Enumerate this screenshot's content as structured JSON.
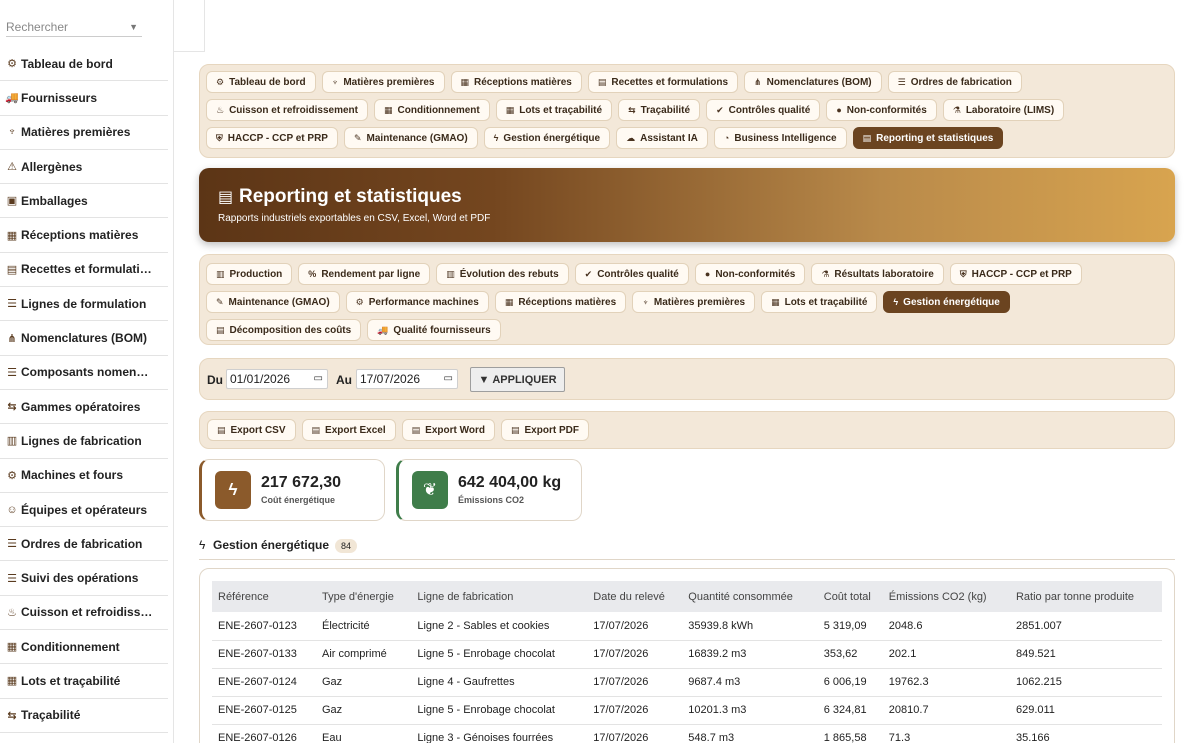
{
  "sidebar": {
    "search_placeholder": "Rechercher",
    "items": [
      {
        "icon": "⚙",
        "label": "Tableau de bord"
      },
      {
        "icon": "🚚",
        "label": "Fournisseurs"
      },
      {
        "icon": "♆",
        "label": "Matières premières"
      },
      {
        "icon": "⚠",
        "label": "Allergènes"
      },
      {
        "icon": "▣",
        "label": "Emballages"
      },
      {
        "icon": "▦",
        "label": "Réceptions matières"
      },
      {
        "icon": "▤",
        "label": "Recettes et formulati…"
      },
      {
        "icon": "☰",
        "label": "Lignes de formulation"
      },
      {
        "icon": "⋔",
        "label": "Nomenclatures (BOM)"
      },
      {
        "icon": "☰",
        "label": "Composants nomen…"
      },
      {
        "icon": "⇆",
        "label": "Gammes opératoires"
      },
      {
        "icon": "▥",
        "label": "Lignes de fabrication"
      },
      {
        "icon": "⚙",
        "label": "Machines et fours"
      },
      {
        "icon": "☺",
        "label": "Équipes et opérateurs"
      },
      {
        "icon": "☰",
        "label": "Ordres de fabrication"
      },
      {
        "icon": "☰",
        "label": "Suivi des opérations"
      },
      {
        "icon": "♨",
        "label": "Cuisson et refroidiss…"
      },
      {
        "icon": "▦",
        "label": "Conditionnement"
      },
      {
        "icon": "▦",
        "label": "Lots et traçabilité"
      },
      {
        "icon": "⇆",
        "label": "Traçabilité"
      }
    ]
  },
  "top_nav": [
    {
      "icon": "⚙",
      "label": "Tableau de bord"
    },
    {
      "icon": "♆",
      "label": "Matières premières"
    },
    {
      "icon": "▦",
      "label": "Réceptions matières"
    },
    {
      "icon": "▤",
      "label": "Recettes et formulations"
    },
    {
      "icon": "⋔",
      "label": "Nomenclatures (BOM)"
    },
    {
      "icon": "☰",
      "label": "Ordres de fabrication"
    },
    {
      "icon": "♨",
      "label": "Cuisson et refroidissement"
    },
    {
      "icon": "▦",
      "label": "Conditionnement"
    },
    {
      "icon": "▦",
      "label": "Lots et traçabilité"
    },
    {
      "icon": "⇆",
      "label": "Traçabilité"
    },
    {
      "icon": "✔",
      "label": "Contrôles qualité"
    },
    {
      "icon": "●",
      "label": "Non-conformités"
    },
    {
      "icon": "⚗",
      "label": "Laboratoire (LIMS)"
    },
    {
      "icon": "⛨",
      "label": "HACCP - CCP et PRP"
    },
    {
      "icon": "✎",
      "label": "Maintenance (GMAO)"
    },
    {
      "icon": "ϟ",
      "label": "Gestion énergétique"
    },
    {
      "icon": "☁",
      "label": "Assistant IA"
    },
    {
      "icon": "◔",
      "label": "Business Intelligence"
    },
    {
      "icon": "▤",
      "label": "Reporting et statistiques",
      "active": true
    }
  ],
  "hero": {
    "icon": "▤",
    "title": "Reporting et statistiques",
    "subtitle": "Rapports industriels exportables en CSV, Excel, Word et PDF"
  },
  "sub_nav": [
    {
      "icon": "▥",
      "label": "Production"
    },
    {
      "icon": "%",
      "label": "Rendement par ligne"
    },
    {
      "icon": "▥",
      "label": "Évolution des rebuts"
    },
    {
      "icon": "✔",
      "label": "Contrôles qualité"
    },
    {
      "icon": "●",
      "label": "Non-conformités"
    },
    {
      "icon": "⚗",
      "label": "Résultats laboratoire"
    },
    {
      "icon": "⛨",
      "label": "HACCP - CCP et PRP"
    },
    {
      "icon": "✎",
      "label": "Maintenance (GMAO)"
    },
    {
      "icon": "⚙",
      "label": "Performance machines"
    },
    {
      "icon": "▦",
      "label": "Réceptions matières"
    },
    {
      "icon": "♆",
      "label": "Matières premières"
    },
    {
      "icon": "▦",
      "label": "Lots et traçabilité"
    },
    {
      "icon": "ϟ",
      "label": "Gestion énergétique",
      "active": true
    },
    {
      "icon": "▤",
      "label": "Décomposition des coûts"
    },
    {
      "icon": "🚚",
      "label": "Qualité fournisseurs"
    }
  ],
  "date_filter": {
    "from_label": "Du",
    "from_value": "01/01/2026",
    "to_label": "Au",
    "to_value": "17/07/2026",
    "apply_label": "APPLIQUER"
  },
  "exports": [
    {
      "icon": "▤",
      "label": "Export CSV"
    },
    {
      "icon": "▤",
      "label": "Export Excel"
    },
    {
      "icon": "▤",
      "label": "Export Word"
    },
    {
      "icon": "▤",
      "label": "Export PDF"
    }
  ],
  "kpis": [
    {
      "value": "217 672,30",
      "caption": "Coût énergétique",
      "color": "#8b5a2b"
    },
    {
      "value": "642 404,00 kg",
      "caption": "Émissions CO2",
      "color": "#3f7d4a"
    }
  ],
  "section": {
    "title": "Gestion énergétique",
    "count": "84"
  },
  "table": {
    "columns": [
      "Référence",
      "Type d'énergie",
      "Ligne de fabrication",
      "Date du relevé",
      "Quantité consommée",
      "Coût total",
      "Émissions CO2 (kg)",
      "Ratio par tonne produite"
    ],
    "rows": [
      [
        "ENE-2607-0123",
        "Électricité",
        "Ligne 2 - Sables et cookies",
        "17/07/2026",
        "35939.8 kWh",
        "5 319,09",
        "2048.6",
        "2851.007"
      ],
      [
        "ENE-2607-0133",
        "Air comprimé",
        "Ligne 5 - Enrobage chocolat",
        "17/07/2026",
        "16839.2 m3",
        "353,62",
        "202.1",
        "849.521"
      ],
      [
        "ENE-2607-0124",
        "Gaz",
        "Ligne 4 - Gaufrettes",
        "17/07/2026",
        "9687.4 m3",
        "6 006,19",
        "19762.3",
        "1062.215"
      ],
      [
        "ENE-2607-0125",
        "Gaz",
        "Ligne 5 - Enrobage chocolat",
        "17/07/2026",
        "10201.3 m3",
        "6 324,81",
        "20810.7",
        "629.011"
      ],
      [
        "ENE-2607-0126",
        "Eau",
        "Ligne 3 - Génoises fourrées",
        "17/07/2026",
        "548.7 m3",
        "1 865,58",
        "71.3",
        "35.166"
      ]
    ]
  }
}
